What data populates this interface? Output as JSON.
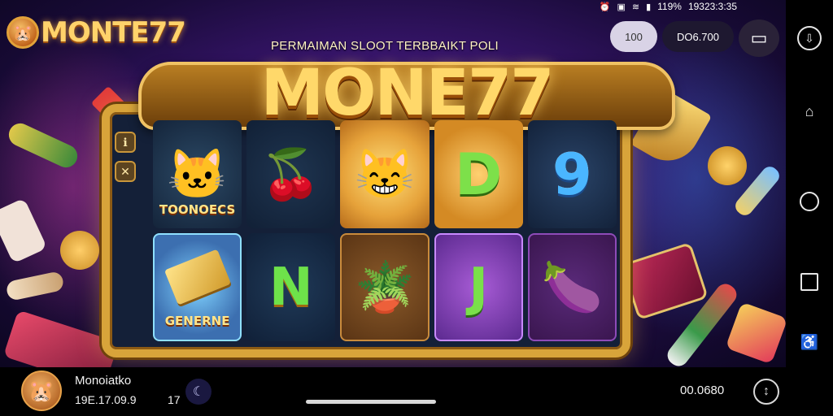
{
  "status_bar": {
    "battery": "119%",
    "time": "19323:3:35"
  },
  "brand": {
    "logo_text": "MONTE77"
  },
  "subtitle": "PERMAIMAN SLOOT TERBBAIKT POLI",
  "title": "MONE77",
  "top_chips": {
    "balance": "100",
    "bet": "DO6.700"
  },
  "reels": [
    {
      "symbol": "cat-face",
      "label": "TOONOECS"
    },
    {
      "symbol": "fruit-cherry",
      "label": ""
    },
    {
      "symbol": "cat-coin",
      "label": ""
    },
    {
      "symbol": "letter",
      "label": "D"
    },
    {
      "symbol": "number",
      "label": "9"
    },
    {
      "symbol": "gold-bar",
      "label": "GENERNE"
    },
    {
      "symbol": "letter",
      "label": "N"
    },
    {
      "symbol": "flower-pot",
      "label": ""
    },
    {
      "symbol": "letter",
      "label": "J"
    },
    {
      "symbol": "eggplant",
      "label": ""
    }
  ],
  "player": {
    "name": "Monoiatko",
    "time": "19E.17.09.9",
    "count": "17",
    "credit": "00.0680"
  },
  "colors": {
    "gold": "#d8a43a",
    "title": "#ffd86a",
    "background": "#3a1670"
  }
}
